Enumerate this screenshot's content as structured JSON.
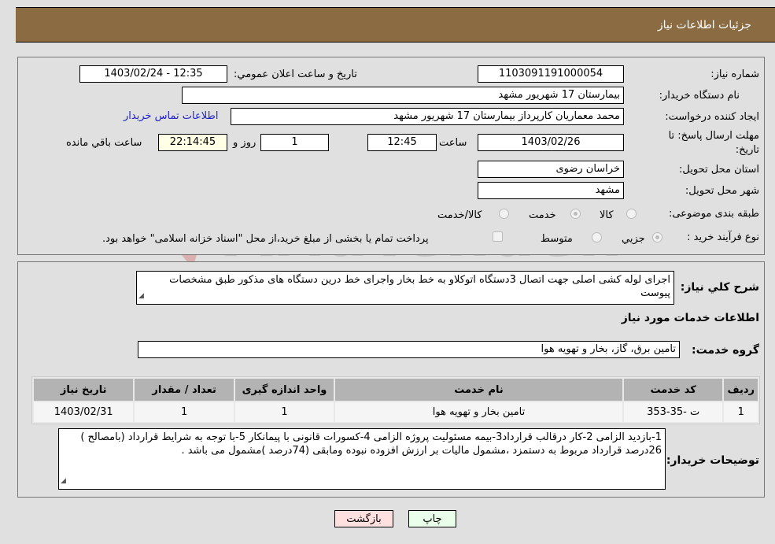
{
  "header": {
    "title": "جزئیات اطلاعات نیاز"
  },
  "fields": {
    "need_number_label": "شماره نیاز:",
    "need_number": "1103091191000054",
    "announce_label": "تاریخ و ساعت اعلان عمومي:",
    "announce_value": "1403/02/24 - 12:35",
    "buyer_org_label": "نام دستگاه خریدار:",
    "buyer_org": "بیمارستان 17 شهریور مشهد",
    "creator_label": "ایجاد کننده درخواست:",
    "creator": "محمد معماریان کارپرداز بیمارستان 17 شهریور مشهد",
    "buyer_contact_link": "اطلاعات تماس خریدار",
    "deadline_label": "مهلت ارسال پاسخ: تا تاریخ:",
    "deadline_date": "1403/02/26",
    "time_label": "ساعت",
    "deadline_time": "12:45",
    "days_value": "1",
    "days_label": "روز و",
    "remaining_time": "22:14:45",
    "remaining_label": "ساعت باقي مانده",
    "province_label": "استان محل تحویل:",
    "province": "خراسان رضوی",
    "city_label": "شهر محل تحویل:",
    "city": "مشهد",
    "category_label": "طبقه بندی موضوعی:",
    "category_options": [
      "کالا",
      "خدمت",
      "کالا/خدمت"
    ],
    "category_selected": "خدمت",
    "process_label": "نوع فرآیند خرید :",
    "process_options": [
      "جزيي",
      "متوسط"
    ],
    "process_selected": "جزيي",
    "treasury_note": "پرداخت تمام یا بخشی از مبلغ خرید،از محل \"اسناد خزانه اسلامی\" خواهد بود."
  },
  "description": {
    "label": "شرح کلي نیاز:",
    "text": "اجرای لوله کشی اصلی جهت اتصال 3دستگاه اتوکلاو به خط بخار واجرای خط درین دستگاه های مذکور طبق مشخصات پیوست"
  },
  "services": {
    "section_title": "اطلاعات خدمات مورد نیاز",
    "group_label": "گروه خدمت:",
    "group_value": "تامین برق، گاز، بخار و تهویه هوا",
    "columns": [
      "ردیف",
      "کد خدمت",
      "نام خدمت",
      "واحد اندازه گیری",
      "تعداد / مقدار",
      "تاریخ نیاز"
    ],
    "rows": [
      {
        "row": "1",
        "code": "ت -35-353",
        "name": "تامین بخار و تهویه هوا",
        "unit": "1",
        "qty": "1",
        "date": "1403/02/31"
      }
    ]
  },
  "buyer_notes": {
    "label": "توضیحات خریدار:",
    "text": "1-بازدید الزامی 2-کار درقالب قرارداد3-بیمه مسئولیت پروژه الزامی 4-کسورات قانونی با پیمانکار 5-با توجه به شرایط قرارداد (بامصالح ) 26درصد قرارداد مربوط به دستمزد ،مشمول مالیات بر ارزش افزوده نبوده ومابقی (74درصد )مشمول می باشد ."
  },
  "buttons": {
    "print": "چاپ",
    "back": "بازگشت"
  },
  "watermark": {
    "text": "AriaTender.neT"
  },
  "colors": {
    "header_bg": "#8b6b42",
    "back_btn_bg": "#ffe0e0",
    "print_btn_bg": "#eaffea",
    "link": "#2222cc"
  }
}
